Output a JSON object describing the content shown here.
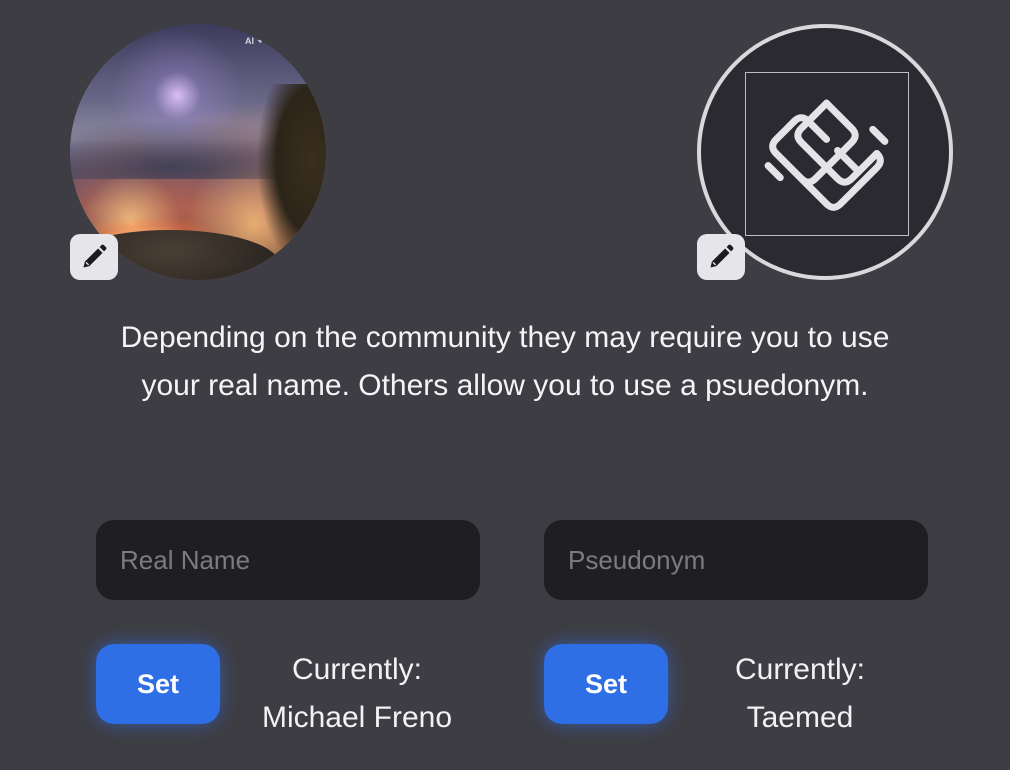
{
  "avatars": {
    "real": {
      "watermark": "AI ✦",
      "edit_icon": "pencil-icon"
    },
    "pseudonym": {
      "logo_icon": "celtic-knot-icon",
      "edit_icon": "pencil-icon"
    }
  },
  "description": "Depending on the community they may require you to use your real name. Others allow you to use a psuedonym.",
  "real_name": {
    "placeholder": "Real Name",
    "value": "",
    "set_label": "Set",
    "current_label": "Currently:",
    "current_value": "Michael Freno"
  },
  "pseudonym": {
    "placeholder": "Pseudonym",
    "value": "",
    "set_label": "Set",
    "current_label": "Currently:",
    "current_value": "Taemed"
  },
  "colors": {
    "background": "#3e3d43",
    "input_background": "#1f1f22",
    "accent": "#2f6fe6",
    "edit_button": "#e6e6ea"
  }
}
